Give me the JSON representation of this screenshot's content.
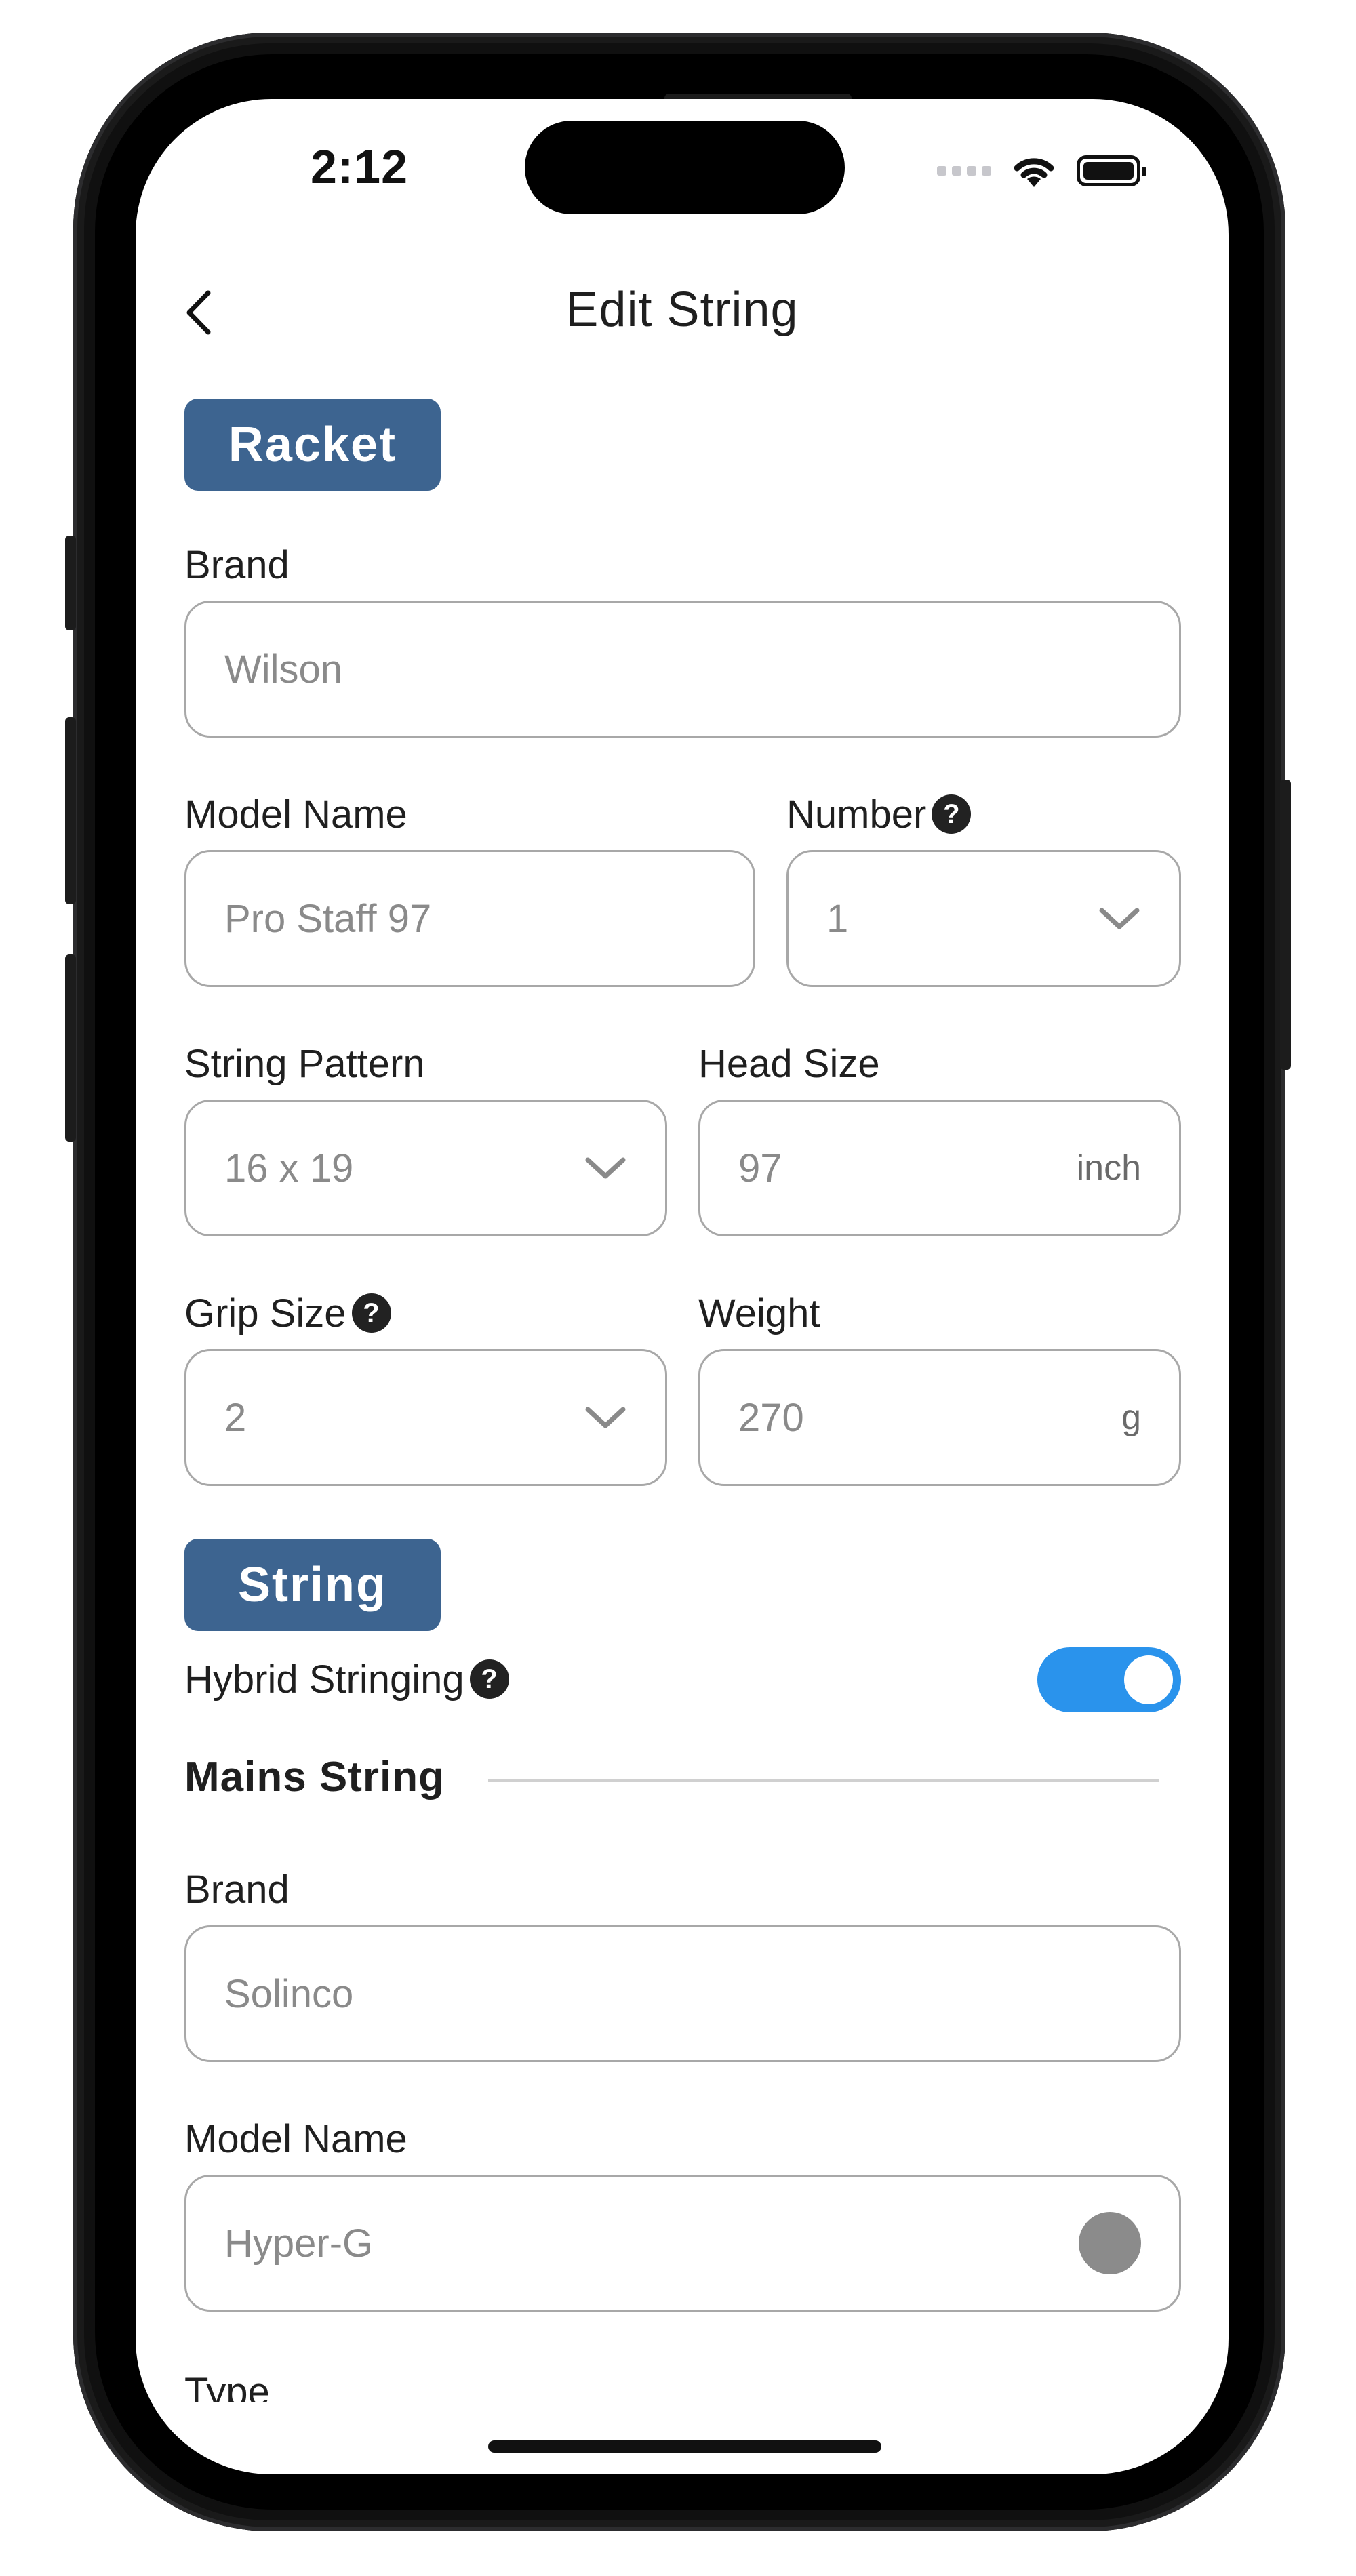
{
  "status_bar": {
    "time": "2:12"
  },
  "nav": {
    "title": "Edit String"
  },
  "racket": {
    "badge": "Racket",
    "brand": {
      "label": "Brand",
      "value": "Wilson"
    },
    "model_name": {
      "label": "Model Name",
      "value": "Pro Staff 97"
    },
    "number": {
      "label": "Number",
      "value": "1"
    },
    "string_pattern": {
      "label": "String Pattern",
      "value": "16 x 19"
    },
    "head_size": {
      "label": "Head Size",
      "value": "97",
      "unit": "inch"
    },
    "grip_size": {
      "label": "Grip Size",
      "value": "2"
    },
    "weight": {
      "label": "Weight",
      "value": "270",
      "unit": "g"
    }
  },
  "string": {
    "badge": "String",
    "hybrid": {
      "label": "Hybrid Stringing",
      "on": true
    },
    "mains_heading": "Mains String",
    "brand": {
      "label": "Brand",
      "value": "Solinco"
    },
    "model_name": {
      "label": "Model Name",
      "value": "Hyper-G"
    },
    "type_label": "Type"
  },
  "colors": {
    "accent_badge": "#3d6490",
    "toggle_on": "#2a93ec"
  },
  "icons": {
    "back": "chevron-left-icon",
    "dropdown": "chevron-down-icon",
    "help": "question-circle-icon"
  }
}
